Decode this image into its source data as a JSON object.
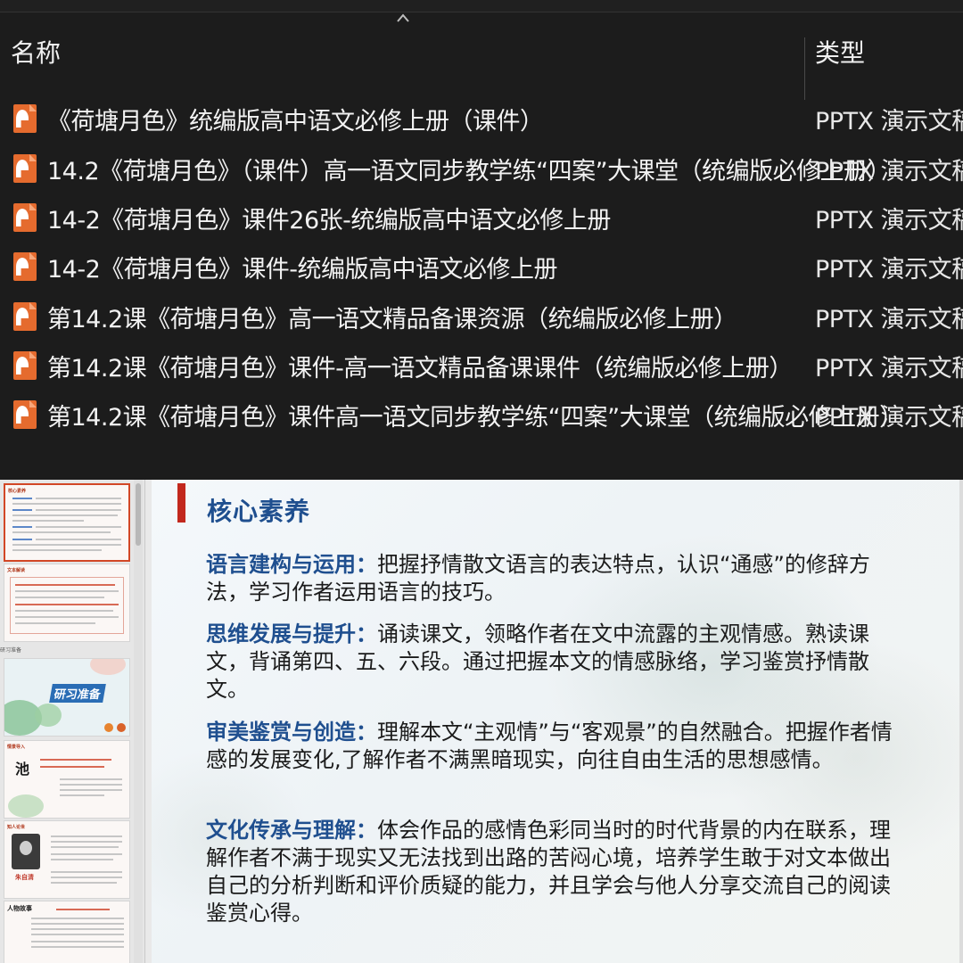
{
  "explorer": {
    "columns": {
      "name": "名称",
      "type": "类型"
    },
    "files": [
      {
        "name": "《荷塘月色》统编版高中语文必修上册（课件）",
        "type": "PPTX 演示文稿"
      },
      {
        "name": "14.2《荷塘月色》（课件）高一语文同步教学练“四案”大课堂（统编版必修上册）",
        "type": "PPTX 演示文稿"
      },
      {
        "name": "14-2《荷塘月色》课件26张-统编版高中语文必修上册",
        "type": "PPTX 演示文稿"
      },
      {
        "name": "14-2《荷塘月色》课件-统编版高中语文必修上册",
        "type": "PPTX 演示文稿"
      },
      {
        "name": "第14.2课《荷塘月色》高一语文精品备课资源（统编版必修上册）",
        "type": "PPTX 演示文稿"
      },
      {
        "name": "第14.2课《荷塘月色》课件-高一语文精品备课课件（统编版必修上册）",
        "type": "PPTX 演示文稿"
      },
      {
        "name": "第14.2课《荷塘月色》课件高一语文同步教学练“四案”大课堂（统编版必修上册）",
        "type": "PPTX 演示文稿"
      }
    ],
    "file_icon": "pptx-file-icon",
    "icon_color": "#e56b2e"
  },
  "ppt": {
    "thumbnails": [
      {
        "heading": "核心素养"
      },
      {
        "heading": "文本解读"
      },
      {
        "section_label": "研习准备",
        "title": "研习准备"
      },
      {
        "heading": "情景导入",
        "big_char": "池"
      },
      {
        "heading": "知人论世",
        "name": "朱自清"
      },
      {
        "heading": "人物故事"
      }
    ],
    "slide": {
      "title": "核心素养",
      "paragraphs": [
        {
          "term": "语言建构与运用：",
          "text": "把握抒情散文语言的表达特点，认识“通感”的修辞方法，学习作者运用语言的技巧。"
        },
        {
          "term": "思维发展与提升：",
          "text": "诵读课文，领略作者在文中流露的主观情感。熟读课文，背诵第四、五、六段。通过把握本文的情感脉络，学习鉴赏抒情散文。"
        },
        {
          "term": "审美鉴赏与创造：",
          "text": "理解本文“主观情”与“客观景”的自然融合。把握作者情感的发展变化,了解作者不满黑暗现实，向往自由生活的思想感情。"
        },
        {
          "term": "文化传承与理解：",
          "text": "体会作品的感情色彩同当时的时代背景的内在联系，理解作者不满于现实又无法找到出路的苦闷心境，培养学生敢于对文本做出自己的分析判断和评价质疑的能力，并且学会与他人分享交流自己的阅读鉴赏心得。"
        }
      ],
      "accent_color": "#c2281d",
      "heading_color": "#1f4f8f"
    }
  }
}
